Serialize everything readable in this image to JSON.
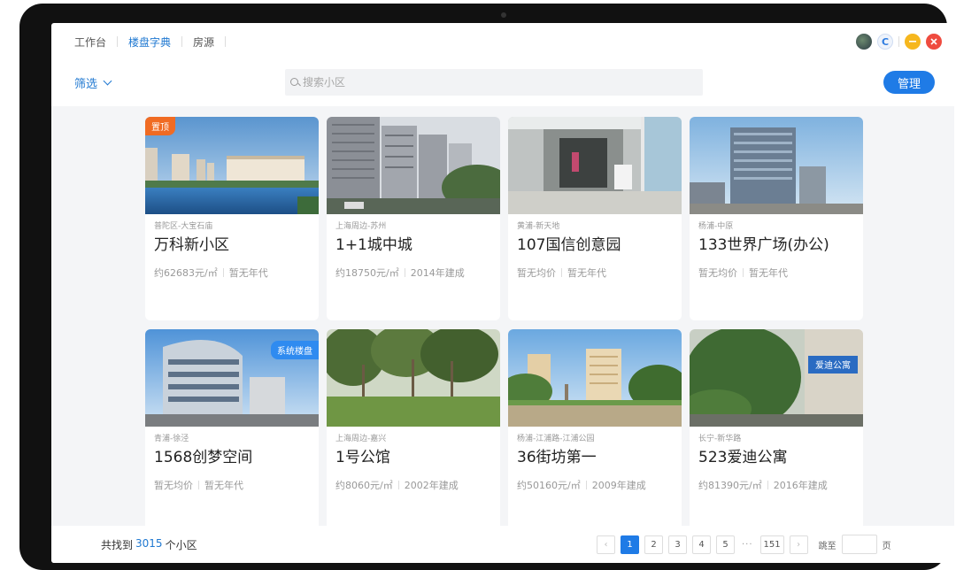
{
  "nav": {
    "tabs": [
      {
        "label": "工作台"
      },
      {
        "label": "楼盘字典"
      },
      {
        "label": "房源"
      }
    ]
  },
  "window_controls": {
    "refresh_glyph": "C"
  },
  "toolbar": {
    "filter_label": "筛选",
    "search_placeholder": "搜索小区",
    "manage_label": "管理"
  },
  "cards": [
    {
      "badge": "置顶",
      "district": "普陀区-大宝石庙",
      "name": "万科新小区",
      "price": "约62683元/㎡",
      "year": "暂无年代"
    },
    {
      "badge": "",
      "district": "上海周边-苏州",
      "name": "1+1城中城",
      "price": "约18750元/㎡",
      "year": "2014年建成"
    },
    {
      "badge": "",
      "district": "黄浦-新天地",
      "name": "107国信创意园",
      "price": "暂无均价",
      "year": "暂无年代"
    },
    {
      "badge": "",
      "district": "杨浦-中原",
      "name": "133世界广场(办公)",
      "price": "暂无均价",
      "year": "暂无年代"
    },
    {
      "badge": "系统楼盘",
      "district": "青浦-徐泾",
      "name": "1568创梦空间",
      "price": "暂无均价",
      "year": "暂无年代"
    },
    {
      "badge": "",
      "district": "上海周边-嘉兴",
      "name": "1号公馆",
      "price": "约8060元/㎡",
      "year": "2002年建成"
    },
    {
      "badge": "",
      "district": "杨浦-江浦路-江浦公园",
      "name": "36街坊第一",
      "price": "约50160元/㎡",
      "year": "2009年建成"
    },
    {
      "badge": "",
      "district": "长宁-新华路",
      "name": "523爱迪公寓",
      "price": "约81390元/㎡",
      "year": "2016年建成",
      "sign": "爱迪公寓"
    }
  ],
  "footer": {
    "total_prefix": "共找到",
    "total_count": "3015",
    "total_suffix": "个小区",
    "pager": {
      "prev": "‹",
      "pages": [
        "1",
        "2",
        "3",
        "4",
        "5"
      ],
      "ellipsis": "···",
      "last": "151",
      "next": "›",
      "goto_label": "跳至",
      "page_suffix": "页"
    }
  },
  "colors": {
    "accent": "#1f7be6",
    "badge_top": "#f06b23",
    "badge_system": "#2f8bf0"
  }
}
